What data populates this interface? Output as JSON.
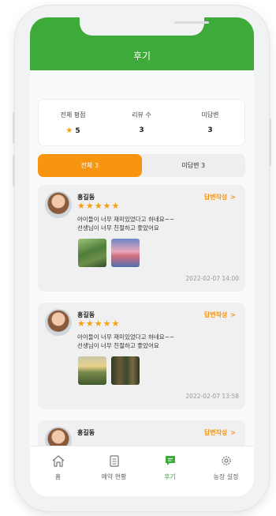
{
  "header": {
    "title": "후기"
  },
  "stats": [
    {
      "label": "전체 평점",
      "value": "5",
      "icon": "star-icon"
    },
    {
      "label": "리뷰 수",
      "value": "3"
    },
    {
      "label": "미답변",
      "value": "3"
    }
  ],
  "tabs": [
    {
      "label": "전체 3",
      "active": true
    },
    {
      "label": "미답변 3",
      "active": false
    }
  ],
  "reviews": [
    {
      "author": "홍길동",
      "rating": "★★★★★",
      "reply_label": "답변작성",
      "reply_icon": ">",
      "line1": "아이들이 너무 재미있었다고 하네요~~",
      "line2": "선생님이 너무 친절하고 좋았어요",
      "date": "2022-02-07 14:00"
    },
    {
      "author": "홍길동",
      "rating": "★★★★★",
      "reply_label": "답변작성",
      "reply_icon": ">",
      "line1": "아이들이 너무 재미있었다고 하네요~~",
      "line2": "선생님이 너무 친절하고 좋았어요",
      "date": "2022-02-07 13:58"
    },
    {
      "author": "홍길동",
      "reply_label": "답변작성",
      "reply_icon": ">"
    }
  ],
  "nav": [
    {
      "label": "홈",
      "icon": "home-icon"
    },
    {
      "label": "예약 현황",
      "icon": "clipboard-icon"
    },
    {
      "label": "후기",
      "icon": "chat-icon",
      "active": true
    },
    {
      "label": "농장 설정",
      "icon": "gear-icon"
    }
  ],
  "colors": {
    "brand_green": "#3daa3a",
    "accent_orange": "#f7950f",
    "star": "#f7a00f"
  }
}
